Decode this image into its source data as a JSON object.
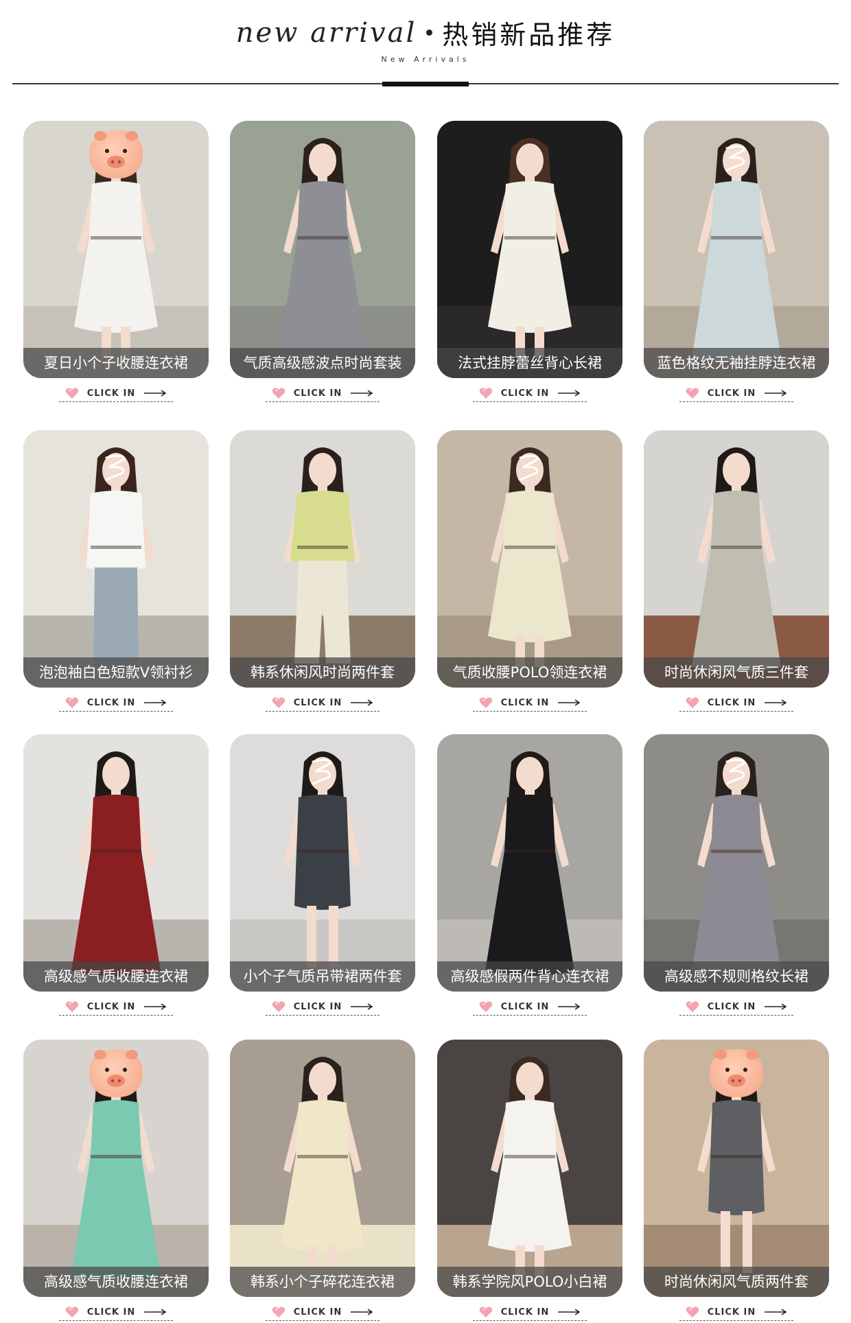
{
  "header": {
    "title_en": "new arrival",
    "title_cn": "热销新品推荐",
    "subtitle": "New Arrivals"
  },
  "click_label": "CLICK IN",
  "products": [
    {
      "name": "夏日小个子收腰连衣裙",
      "bg": "#d9d6cf",
      "floor": "#c6c2b9",
      "outfit": "#f4f2ee",
      "hair": "#3b2a22",
      "style": "dress",
      "face": "pig"
    },
    {
      "name": "气质高级感波点时尚套装",
      "bg": "#9aa296",
      "floor": "#8d8f89",
      "outfit": "#8d8f95",
      "hair": "#2a211c",
      "style": "long",
      "face": "plain"
    },
    {
      "name": "法式挂脖蕾丝背心长裙",
      "bg": "#1e1d1d",
      "floor": "#2a2828",
      "outfit": "#f1efe5",
      "hair": "#4a2f24",
      "style": "dress",
      "face": "plain"
    },
    {
      "name": "蓝色格纹无袖挂脖连衣裙",
      "bg": "#c9c2b4",
      "floor": "#b3a99a",
      "outfit": "#cdd8da",
      "hair": "#2a211c",
      "style": "long",
      "face": "scribble"
    },
    {
      "name": "泡泡袖白色短款V领衬衫",
      "bg": "#e6e3dd",
      "floor": "#b7b5ae",
      "outfit": "#f6f6f4",
      "hair": "#3a241d",
      "style": "top",
      "face": "scribble"
    },
    {
      "name": "韩系休闲风时尚两件套",
      "bg": "#dcdad5",
      "floor": "#8c7b68",
      "outfit": "#d8dc8f",
      "hair": "#2a211c",
      "style": "set",
      "face": "plain"
    },
    {
      "name": "气质收腰POLO领连衣裙",
      "bg": "#c4b7a6",
      "floor": "#a99a87",
      "outfit": "#ece7cc",
      "hair": "#3b2a22",
      "style": "dress",
      "face": "scribble"
    },
    {
      "name": "时尚休闲风气质三件套",
      "bg": "#d6d4d0",
      "floor": "#8b5a44",
      "outfit": "#c2bdb1",
      "hair": "#1f1a17",
      "style": "long",
      "face": "plain"
    },
    {
      "name": "高级感气质收腰连衣裙",
      "bg": "#e4e2de",
      "floor": "#b9b5ae",
      "outfit": "#8a1f22",
      "hair": "#1f1a17",
      "style": "long",
      "face": "plain"
    },
    {
      "name": "小个子气质吊带裙两件套",
      "bg": "#dedcda",
      "floor": "#c9c7c4",
      "outfit": "#3b3f46",
      "hair": "#1f1a17",
      "style": "short",
      "face": "scribble"
    },
    {
      "name": "高级感假两件背心连衣裙",
      "bg": "#a8a6a3",
      "floor": "#bdbab5",
      "outfit": "#1a1a1c",
      "hair": "#1f1a17",
      "style": "long",
      "face": "plain"
    },
    {
      "name": "高级感不规则格纹长裙",
      "bg": "#8d8c87",
      "floor": "#777672",
      "outfit": "#8e8a93",
      "hair": "#2a211c",
      "style": "long",
      "face": "scribble"
    },
    {
      "name": "高级感气质收腰连衣裙",
      "bg": "#d7d4cf",
      "floor": "#b9b3aa",
      "outfit": "#7cc9b1",
      "hair": "#1f1a17",
      "style": "long",
      "face": "pig"
    },
    {
      "name": "韩系小个子碎花连衣裙",
      "bg": "#a79d92",
      "floor": "#e9e2c9",
      "outfit": "#efe7c7",
      "hair": "#2a211c",
      "style": "dress",
      "face": "plain"
    },
    {
      "name": "韩系学院风POLO小白裙",
      "bg": "#4a4542",
      "floor": "#b9a58f",
      "outfit": "#f4f3f0",
      "hair": "#3b2a22",
      "style": "dress",
      "face": "plain"
    },
    {
      "name": "时尚休闲风气质两件套",
      "bg": "#c9b49d",
      "floor": "#a48b73",
      "outfit": "#5e5f63",
      "hair": "#1f1a17",
      "style": "short",
      "face": "pig"
    }
  ]
}
